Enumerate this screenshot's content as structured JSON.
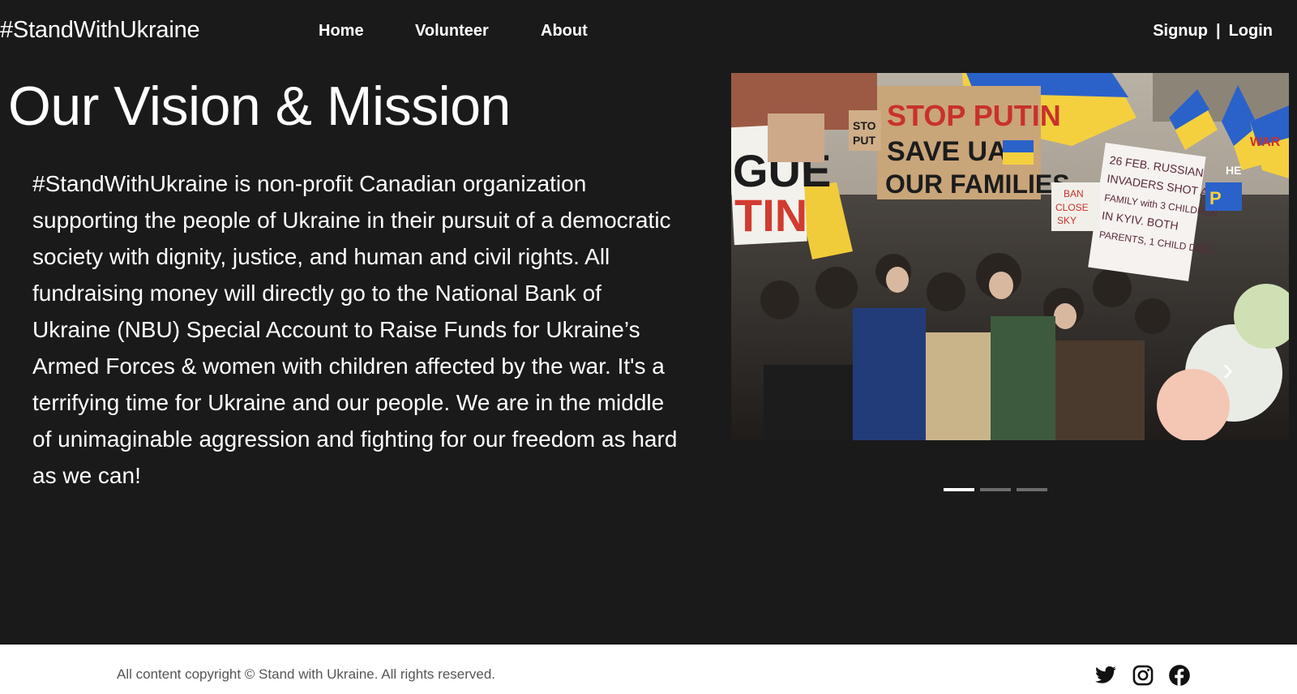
{
  "header": {
    "brand": "#StandWithUkraine",
    "nav": {
      "home": "Home",
      "volunteer": "Volunteer",
      "about": "About"
    },
    "signup": "Signup",
    "separator": "|",
    "login": "Login"
  },
  "main": {
    "title": "Our Vision & Mission",
    "mission_text": "#StandWithUkraine is non-profit Canadian organization supporting the people of Ukraine in their pursuit of a democratic society with dignity, justice, and human and civil rights. All fundraising money will directly go to the National Bank of Ukraine (NBU) Special Account to Raise Funds for Ukraine’s Armed Forces & women with children affected by the war. It's a terrifying time for Ukraine and our people. We are in the middle of unimaginable aggression and fighting for our freedom as hard as we can!"
  },
  "carousel": {
    "slide_count": 3,
    "active_index": 0,
    "signs": {
      "main_sign": [
        "STOP PUTIN",
        "SAVE UA",
        "OUR FAMILIES"
      ],
      "left_sign": [
        "GUE",
        "TIN"
      ],
      "right_sign": [
        "26 FEB. RUSSIAN",
        "INVADERS SHOT A",
        "FAMILY with 3 CHILDREN",
        "IN KYIV. BOTH",
        "PARENTS, 1 CHILD DIED"
      ],
      "small_signs": [
        "BAN",
        "CLOSE",
        "SKY",
        "STO",
        "PUT",
        "HE",
        "WAR",
        "P"
      ]
    },
    "next_arrow": "›",
    "colors": {
      "ukraine_blue": "#1f5fbf",
      "ukraine_yellow": "#f4d03f"
    }
  },
  "footer": {
    "copyright": "All content copyright © Stand with Ukraine. All rights reserved.",
    "icons": [
      "twitter-icon",
      "instagram-icon",
      "facebook-icon"
    ]
  },
  "colors": {
    "background": "#1a1a1a",
    "footer_bg": "#ffffff",
    "text": "#ffffff"
  }
}
